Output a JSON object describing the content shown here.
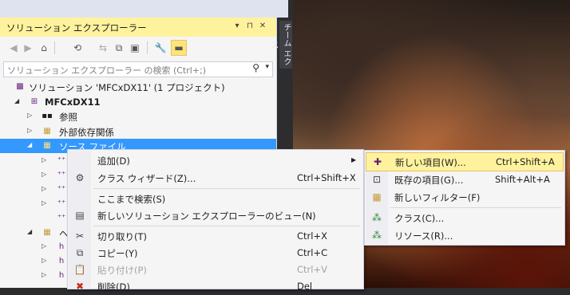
{
  "panel": {
    "title": "ソリューション エクスプローラー",
    "title_pin": "▾",
    "title_autohide": "⊓",
    "title_close": "✕",
    "side_tab": "チーム エクス"
  },
  "toolbar": {
    "icons": [
      "back-icon",
      "forward-icon",
      "home-icon",
      "history-icon",
      "sync-icon",
      "collapse-all-icon",
      "show-all-files-icon",
      "properties-icon",
      "preview-icon"
    ]
  },
  "search": {
    "placeholder": "ソリューション エクスプローラー の検索 (Ctrl+;)"
  },
  "tree": {
    "solution": "ソリューション 'MFCxDX11' (1 プロジェクト)",
    "project": "MFCxDX11",
    "references": "参照",
    "external_deps": "外部依存関係",
    "source_files": "ソース ファイル",
    "header_partial": "ヘ"
  },
  "context_menu": {
    "items": [
      {
        "label": "追加(D)",
        "shortcut": "",
        "has_submenu": true
      },
      {
        "label": "クラス ウィザード(Z)...",
        "shortcut": "Ctrl+Shift+X"
      },
      {
        "label": "ここまで検索(S)",
        "shortcut": ""
      },
      {
        "label": "新しいソリューション エクスプローラーのビュー(N)",
        "shortcut": ""
      },
      {
        "label": "切り取り(T)",
        "shortcut": "Ctrl+X"
      },
      {
        "label": "コピー(Y)",
        "shortcut": "Ctrl+C"
      },
      {
        "label": "貼り付け(P)",
        "shortcut": "Ctrl+V"
      },
      {
        "label": "削除(D)",
        "shortcut": "Del"
      }
    ],
    "submenu_arrow": "▶"
  },
  "submenu": {
    "items": [
      {
        "label": "新しい項目(W)...",
        "shortcut": "Ctrl+Shift+A"
      },
      {
        "label": "既存の項目(G)...",
        "shortcut": "Shift+Alt+A"
      },
      {
        "label": "新しいフィルター(F)",
        "shortcut": ""
      },
      {
        "label": "クラス(C)...",
        "shortcut": ""
      },
      {
        "label": "リソース(R)...",
        "shortcut": ""
      }
    ]
  },
  "colors": {
    "selection": "#3399ff",
    "highlight": "#fff29d",
    "accent_purple": "#68217a"
  }
}
